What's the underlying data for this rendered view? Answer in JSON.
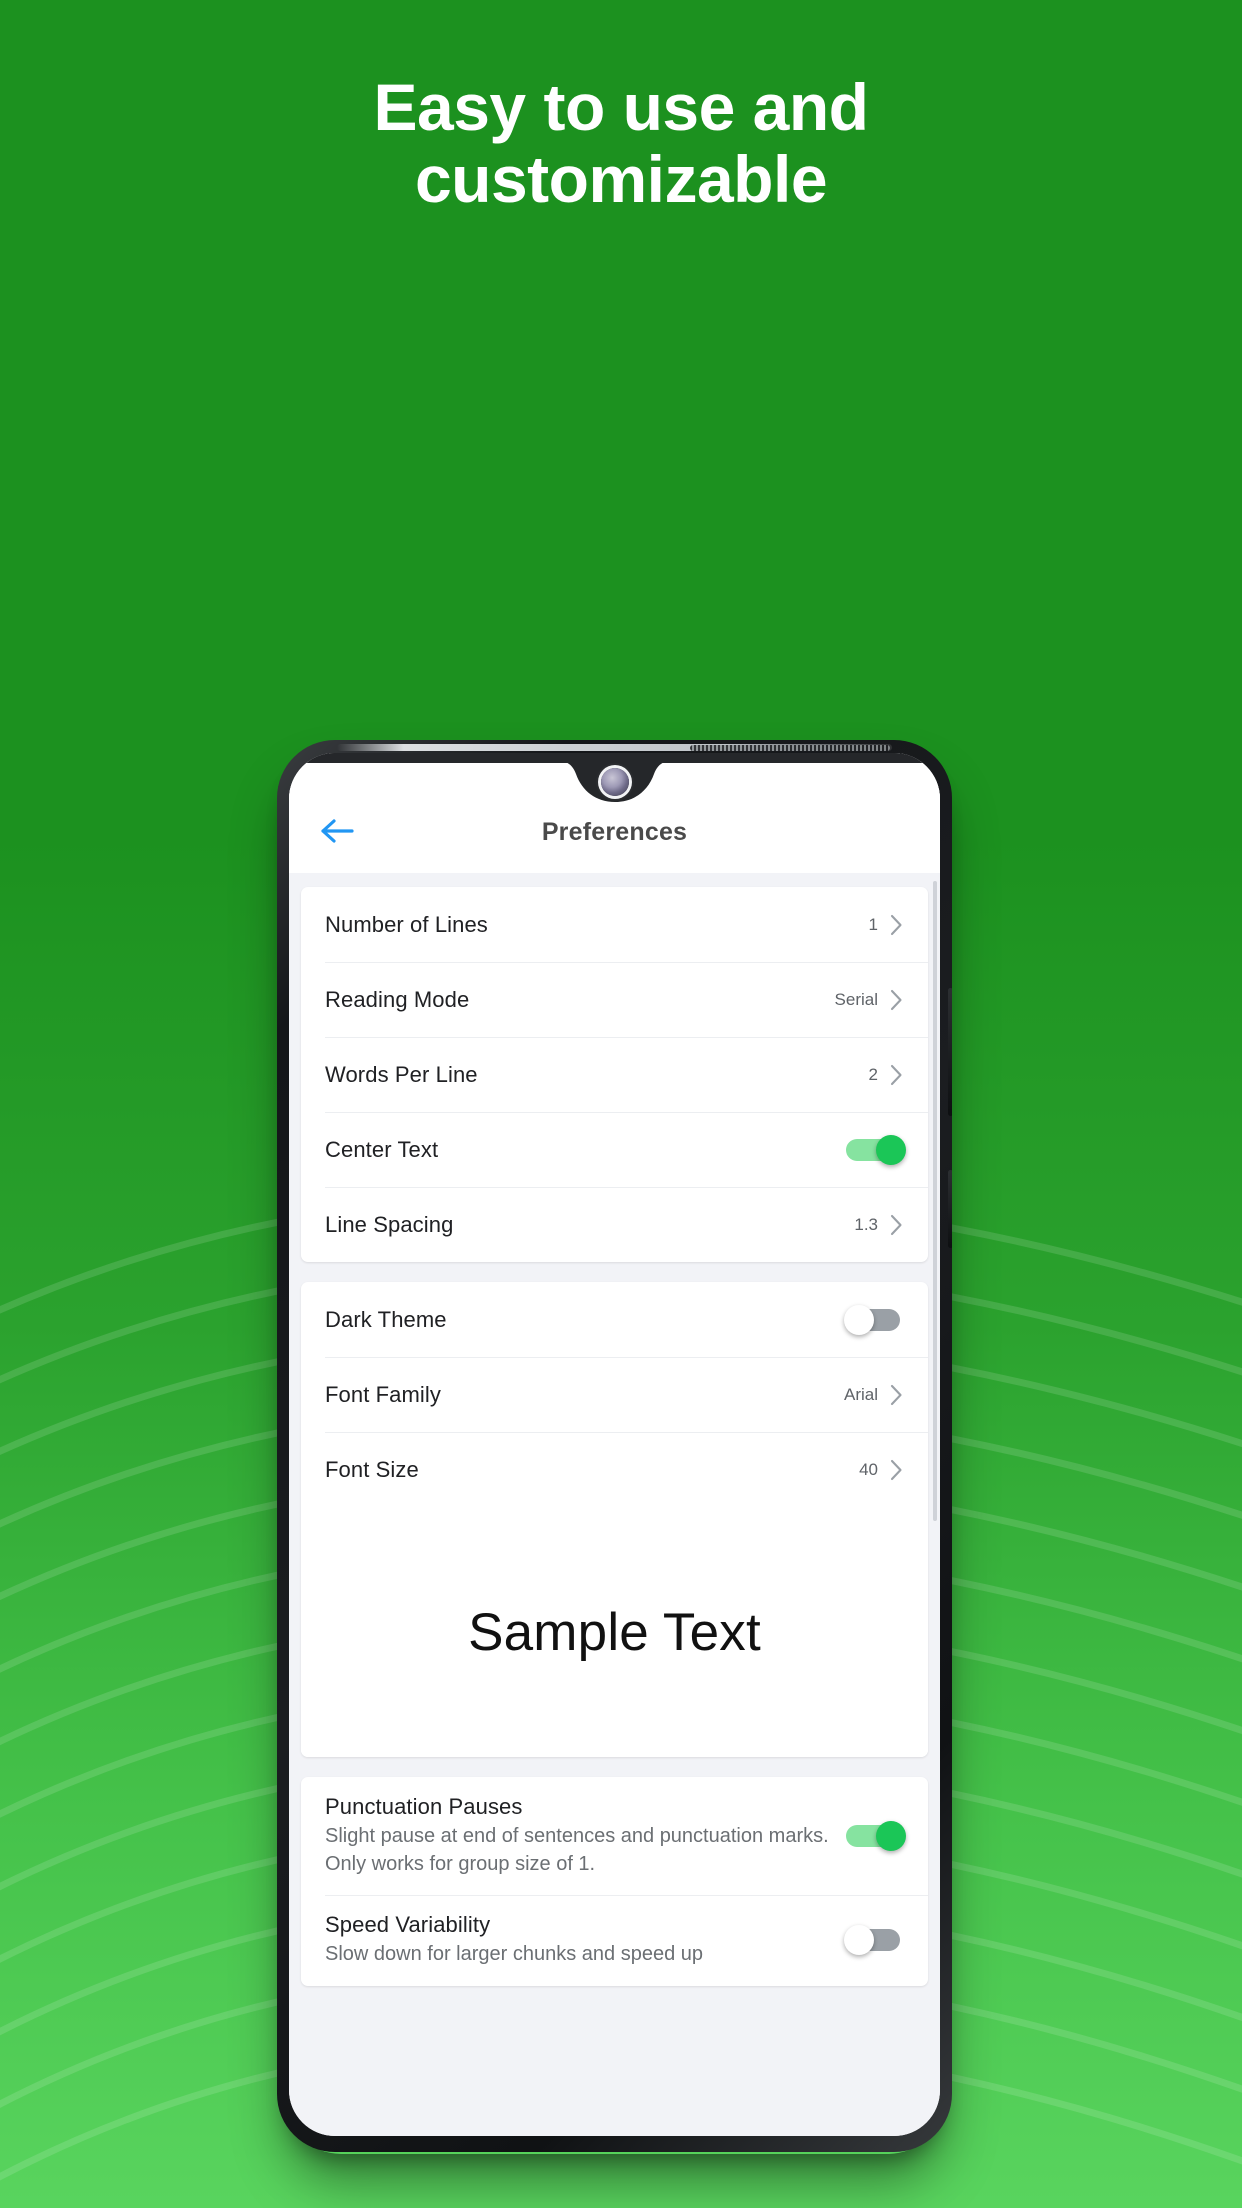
{
  "promo": {
    "headline_line1": "Easy to use and",
    "headline_line2": "customizable",
    "background_color": "#1c911f",
    "accent_color": "#1bc657"
  },
  "phone": {
    "status": {
      "notch": "waterdrop-notch",
      "camera": "front-camera"
    }
  },
  "app": {
    "appbar": {
      "back_label": "back-arrow",
      "title": "Preferences",
      "back_icon_color": "#2196f3",
      "title_color": "#4a4a4a"
    },
    "sections": [
      {
        "id": "reading",
        "rows": [
          {
            "label": "Number of Lines",
            "value": "1",
            "type": "chevron"
          },
          {
            "label": "Reading Mode",
            "value": "Serial",
            "type": "chevron"
          },
          {
            "label": "Words Per Line",
            "value": "2",
            "type": "chevron"
          },
          {
            "label": "Center Text",
            "value": "on",
            "type": "switch"
          },
          {
            "label": "Line Spacing",
            "value": "1.3",
            "type": "chevron"
          }
        ]
      },
      {
        "id": "appearance",
        "rows": [
          {
            "label": "Dark Theme",
            "value": "off",
            "type": "switch"
          },
          {
            "label": "Font Family",
            "value": "Arial",
            "type": "chevron"
          },
          {
            "label": "Font Size",
            "value": "40",
            "type": "chevron"
          }
        ],
        "preview": {
          "text": "Sample Text"
        }
      },
      {
        "id": "timing",
        "rows": [
          {
            "label": "Punctuation Pauses",
            "subtitle": "Slight pause at end of sentences and punctuation marks. Only works for group size of 1.",
            "value": "on",
            "type": "switch"
          },
          {
            "label": "Speed Variability",
            "subtitle": "Slow down for larger chunks and speed up",
            "value": "off",
            "type": "switch"
          }
        ]
      }
    ]
  }
}
